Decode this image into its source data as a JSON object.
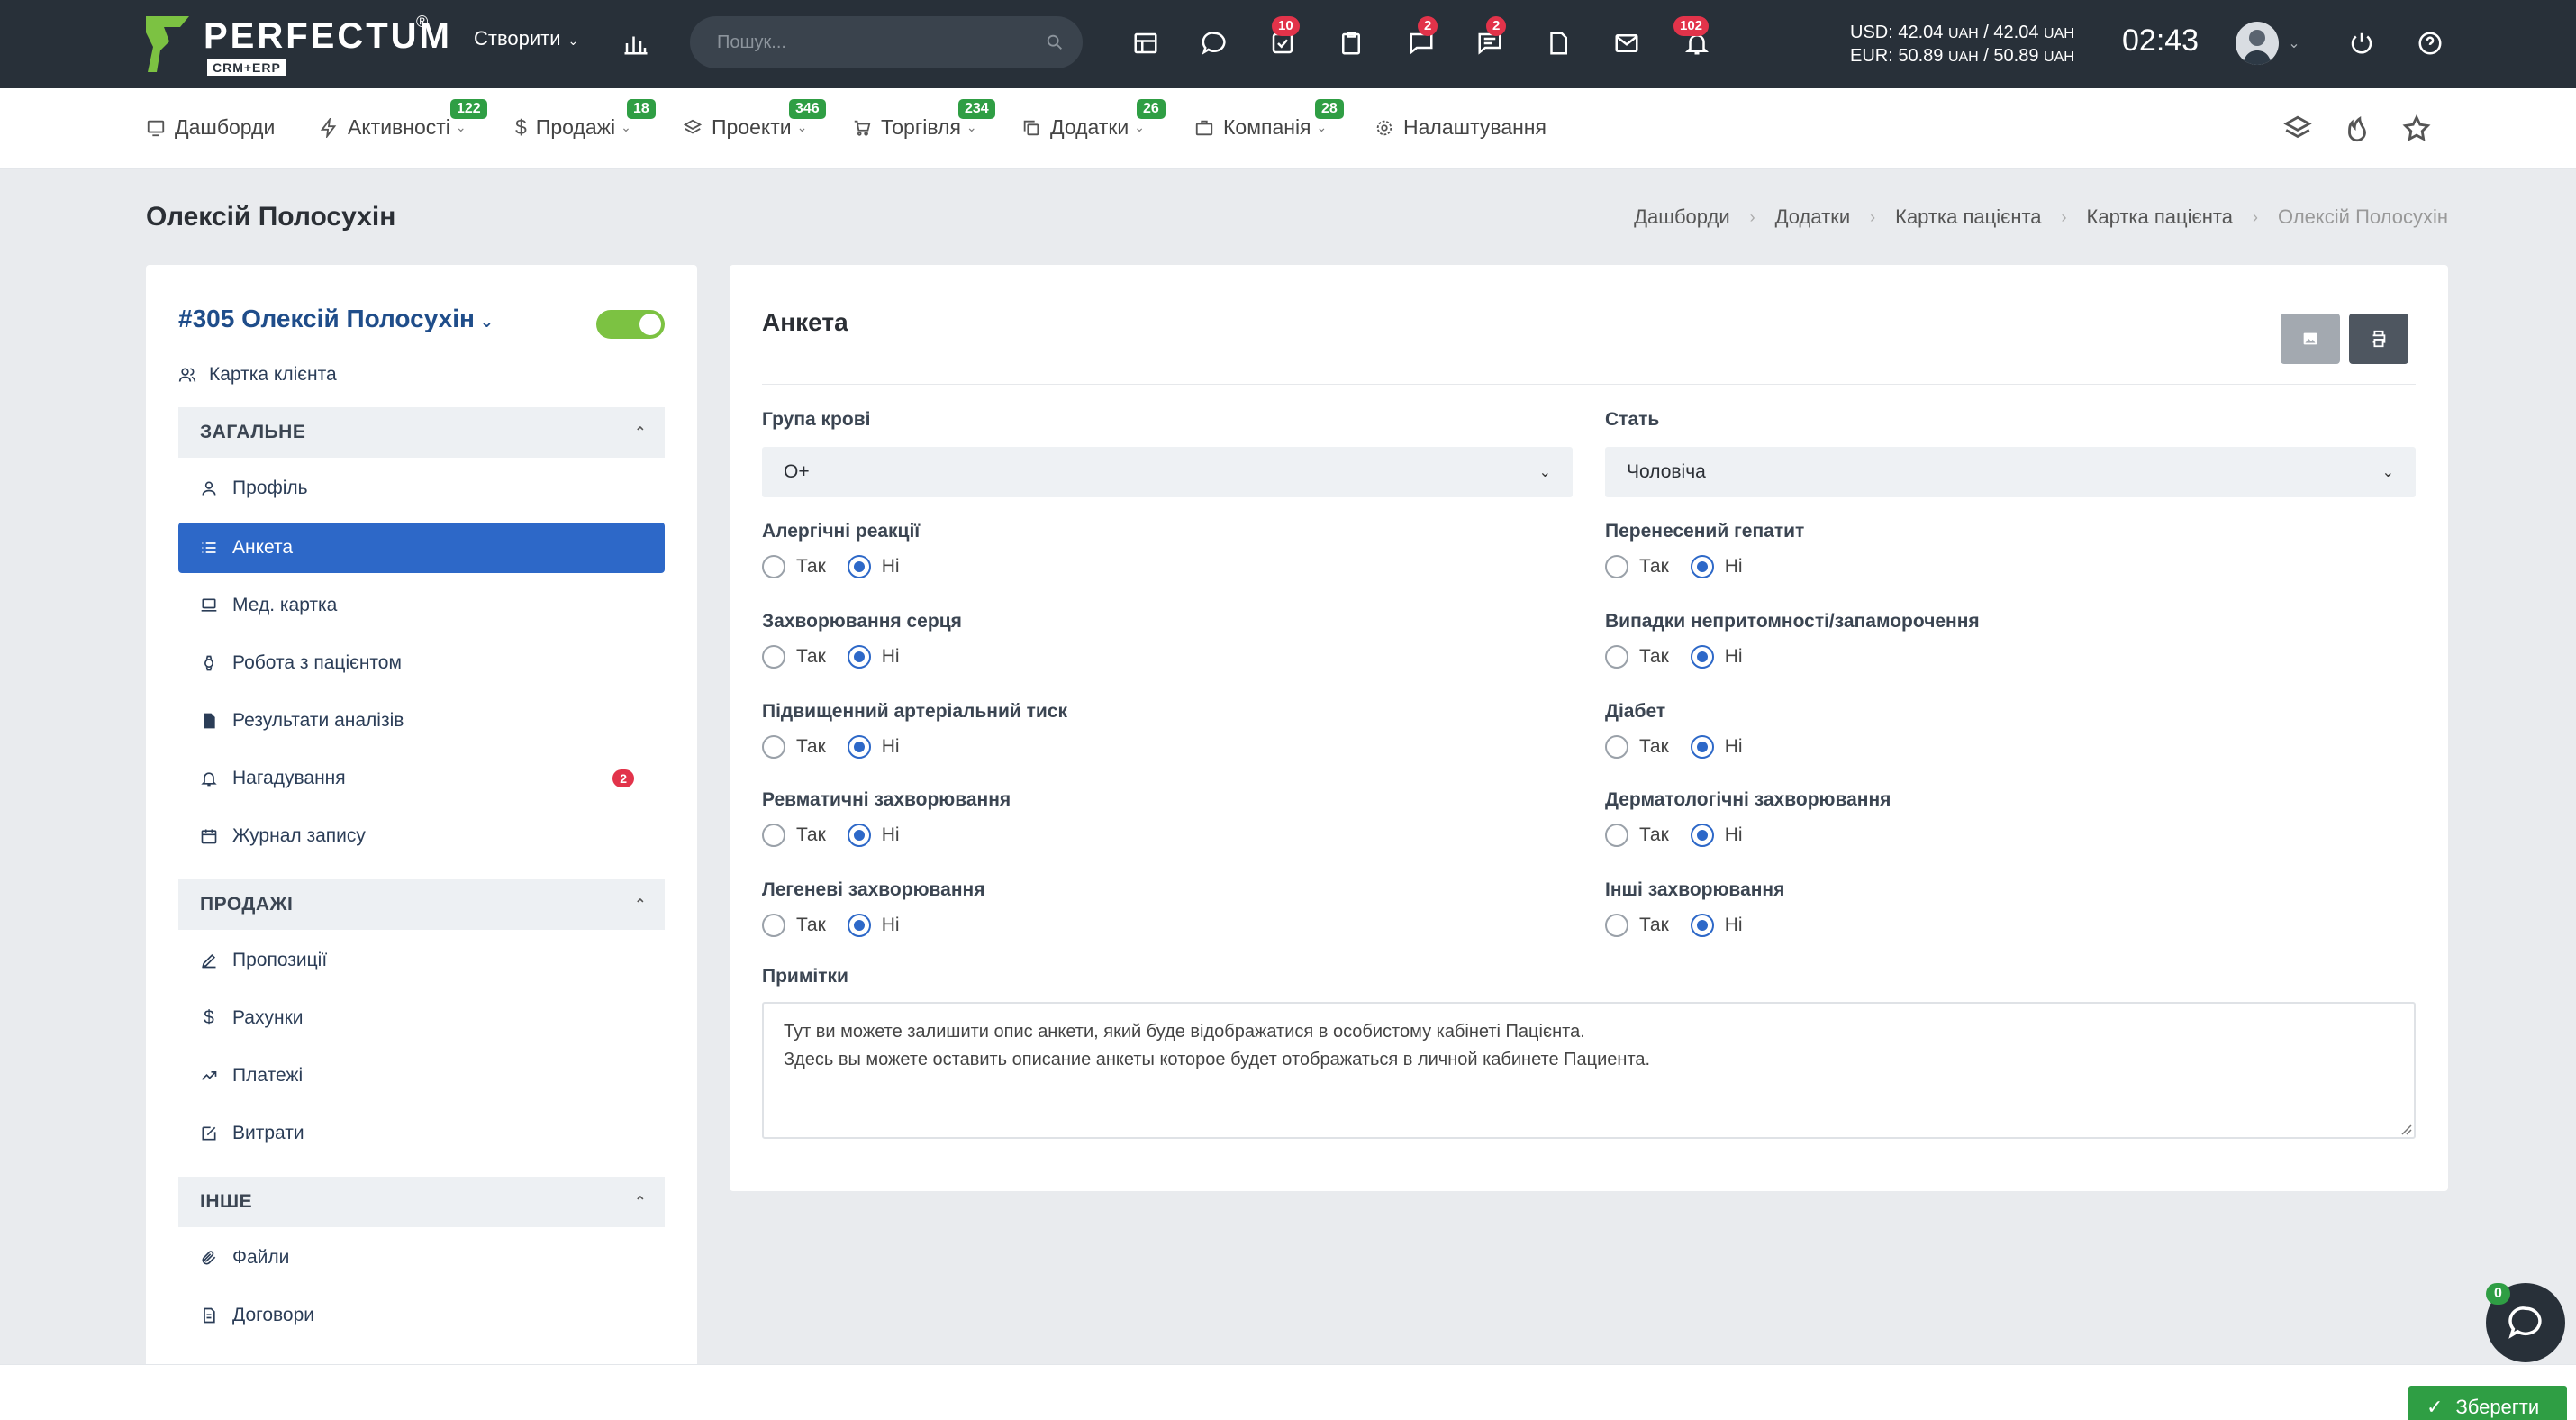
{
  "header": {
    "logo_word": "PERFECTUM",
    "logo_reg": "®",
    "logo_sub": "CRM+ERP",
    "create_label": "Створити",
    "search_placeholder": "Пошук...",
    "badges": {
      "tasks": "10",
      "chat": "2",
      "messages": "2",
      "notifications": "102"
    },
    "currency_usd_label": "USD: 42.04",
    "currency_usd_unit1": "UAH",
    "currency_usd_mid": " / 42.04",
    "currency_usd_unit2": "UAH",
    "currency_eur_label": "EUR: 50.89",
    "currency_eur_unit1": "UAH",
    "currency_eur_mid": " / 50.89",
    "currency_eur_unit2": "UAH",
    "clock": "02:43"
  },
  "menu": {
    "items": [
      {
        "label": "Дашборди",
        "badge": ""
      },
      {
        "label": "Активності",
        "badge": "122"
      },
      {
        "label": "Продажі",
        "badge": "18"
      },
      {
        "label": "Проекти",
        "badge": "346"
      },
      {
        "label": "Торгівля",
        "badge": "234"
      },
      {
        "label": "Додатки",
        "badge": "26"
      },
      {
        "label": "Компанія",
        "badge": "28"
      },
      {
        "label": "Налаштування",
        "badge": ""
      }
    ]
  },
  "page": {
    "title": "Олексій Полосухін",
    "breadcrumbs": [
      "Дашборди",
      "Додатки",
      "Картка пацієнта",
      "Картка пацієнта",
      "Олексій Полосухін"
    ]
  },
  "sidebar": {
    "client_name": "#305 Олексій Полосухін",
    "client_card": "Картка клієнта",
    "section_general": "ЗАГАЛЬНЕ",
    "section_sales": "ПРОДАЖІ",
    "section_other": "ІНШЕ",
    "general_items": [
      {
        "label": "Профіль"
      },
      {
        "label": "Анкета"
      },
      {
        "label": "Мед. картка"
      },
      {
        "label": "Робота з пацієнтом"
      },
      {
        "label": "Результати аналізів"
      },
      {
        "label": "Нагадування",
        "badge": "2"
      },
      {
        "label": "Журнал запису"
      }
    ],
    "sales_items": [
      {
        "label": "Пропозиції"
      },
      {
        "label": "Рахунки"
      },
      {
        "label": "Платежі"
      },
      {
        "label": "Витрати"
      }
    ],
    "other_items": [
      {
        "label": "Файли"
      },
      {
        "label": "Договори"
      }
    ]
  },
  "form": {
    "title": "Анкета",
    "blood_group_label": "Група крові",
    "blood_group_value": "O+",
    "sex_label": "Стать",
    "sex_value": "Чоловіча",
    "yes_label": "Так",
    "no_label": "Ні",
    "questions_left": [
      {
        "label": "Алергічні реакції",
        "value": "no"
      },
      {
        "label": "Захворювання серця",
        "value": "no"
      },
      {
        "label": "Підвищенний артеріальний тиск",
        "value": "no"
      },
      {
        "label": "Ревматичні захворювання",
        "value": "no"
      },
      {
        "label": "Легеневі захворювання",
        "value": "no"
      }
    ],
    "questions_right": [
      {
        "label": "Перенесений гепатит",
        "value": "no"
      },
      {
        "label": "Випадки непритомності/запаморочення",
        "value": "no"
      },
      {
        "label": "Діабет",
        "value": "no"
      },
      {
        "label": "Дерматологічні захворювання",
        "value": "no"
      },
      {
        "label": "Інші захворювання",
        "value": "no"
      }
    ],
    "notes_label": "Примітки",
    "notes_line1": "Тут ви можете залишити опис анкети, який буде відображатися в особистому кабінеті Пацієнта.",
    "notes_line2": "Здесь вы можете оставить описание анкеты которое будет отображаться в личной кабинете Пациента."
  },
  "footer": {
    "save_label": "Зберегти",
    "chat_badge": "0"
  },
  "colors": {
    "topbar": "#283039",
    "accent": "#2d68c8",
    "success": "#2f9e44",
    "danger": "#e2334a"
  }
}
